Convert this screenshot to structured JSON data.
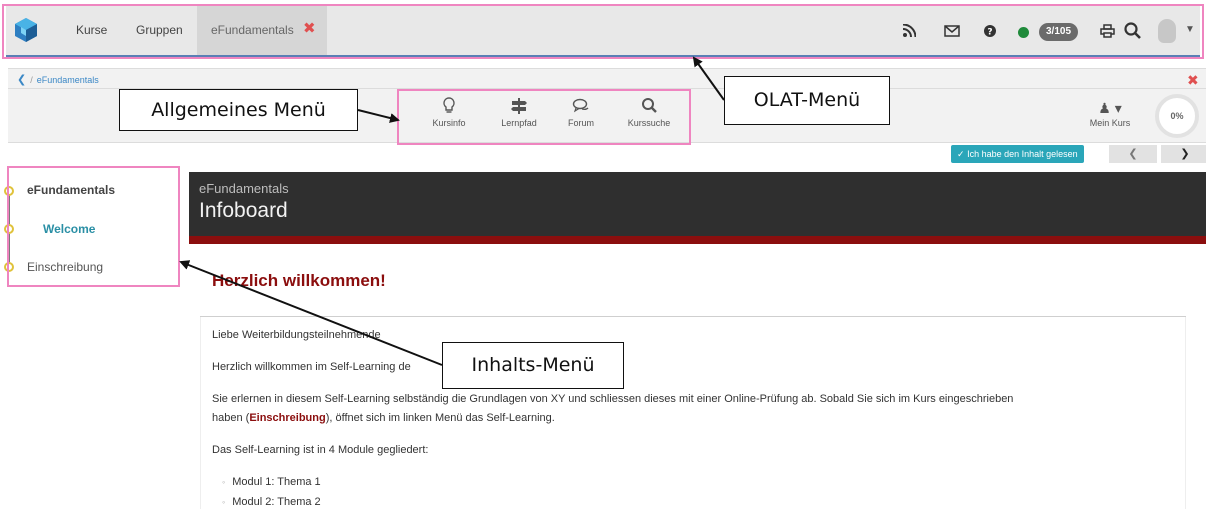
{
  "top_nav": {
    "links": [
      "Kurse",
      "Gruppen"
    ],
    "active_tab": "eFundamentals",
    "close_glyph": "✖",
    "icons": [
      "rss-icon",
      "mail-icon",
      "help-icon",
      "status-online-icon",
      "print-icon",
      "search-icon",
      "avatar",
      "caret-down-icon"
    ],
    "count_badge": "3/105"
  },
  "breadcrumb": {
    "current": "eFundamentals"
  },
  "toolbar": {
    "tools": [
      {
        "label": "Kursinfo",
        "icon": "lightbulb-icon"
      },
      {
        "label": "Lernpfad",
        "icon": "signpost-icon"
      },
      {
        "label": "Forum",
        "icon": "chat-icon"
      },
      {
        "label": "Kurssuche",
        "icon": "search-icon"
      }
    ],
    "my_course_label": "Mein Kurs",
    "progress_label": "0%",
    "read_button_label": "Ich habe den Inhalt gelesen"
  },
  "side_menu": {
    "root": "eFundamentals",
    "items": [
      "Welcome",
      "Einschreibung"
    ]
  },
  "content": {
    "banner_subtitle": "eFundamentals",
    "banner_title": "Infoboard",
    "heading": "Herzlich willkommen!",
    "para1": "Liebe Weiterbildungsteilnehmende",
    "para2": "Herzlich willkommen im Self-Learning de",
    "para3a": "Sie erlernen in diesem Self-Learning selbständig die Grundlagen von XY und schliessen dieses mit einer Online-Prüfung ab. Sobald Sie sich im Kurs eingeschrieben",
    "para3b_pre": "haben (",
    "para3b_link": "Einschreibung",
    "para3b_post": "), öffnet sich im linken Menü das Self-Learning.",
    "para4": "Das Self-Learning ist in 4 Module gegliedert:",
    "modules": [
      "Modul 1: Thema 1",
      "Modul 2: Thema 2"
    ]
  },
  "annotations": {
    "general_menu": "Allgemeines Menü",
    "olat_menu": "OLAT-Menü",
    "content_menu": "Inhalts-Menü",
    "highlight_color": "#ef85c0"
  }
}
